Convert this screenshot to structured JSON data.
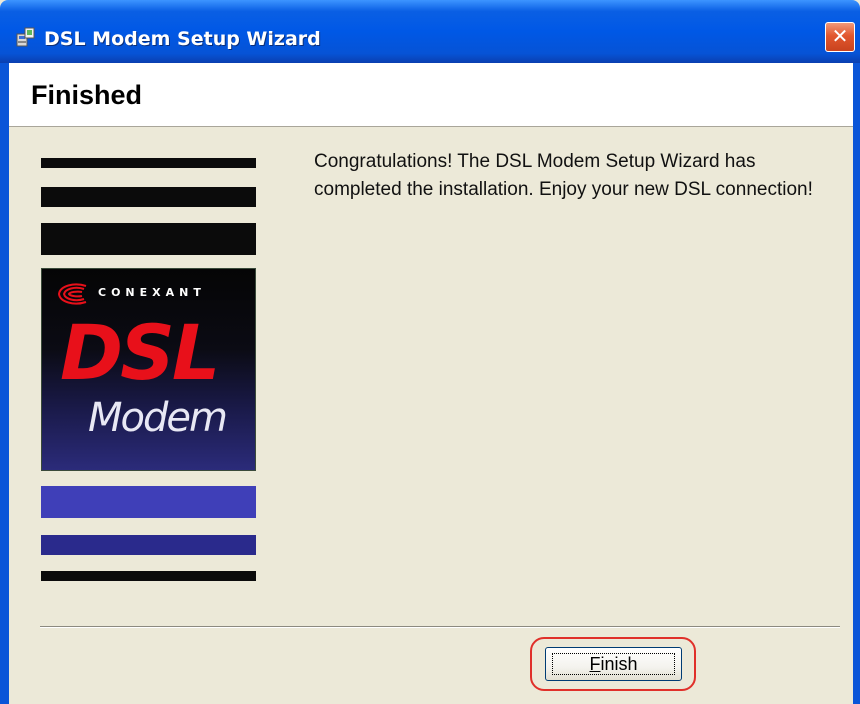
{
  "window": {
    "title": "DSL Modem Setup Wizard",
    "close_symbol": "✕",
    "title_icon": "setup-icon"
  },
  "header": {
    "title": "Finished"
  },
  "logo": {
    "brand": "CONEXANT",
    "product_line1": "DSL",
    "product_line2": "Modem"
  },
  "message": "Congratulations!  The DSL Modem Setup Wizard has completed the installation.  Enjoy your new DSL connection!",
  "buttons": {
    "finish_label_first": "F",
    "finish_label_rest": "inish"
  },
  "colors": {
    "titlebar": "#0058e6",
    "background": "#ece9d8",
    "dsl_red": "#e8101a",
    "stripe_blue": "#3c3cb4",
    "highlight": "#e0302a"
  }
}
